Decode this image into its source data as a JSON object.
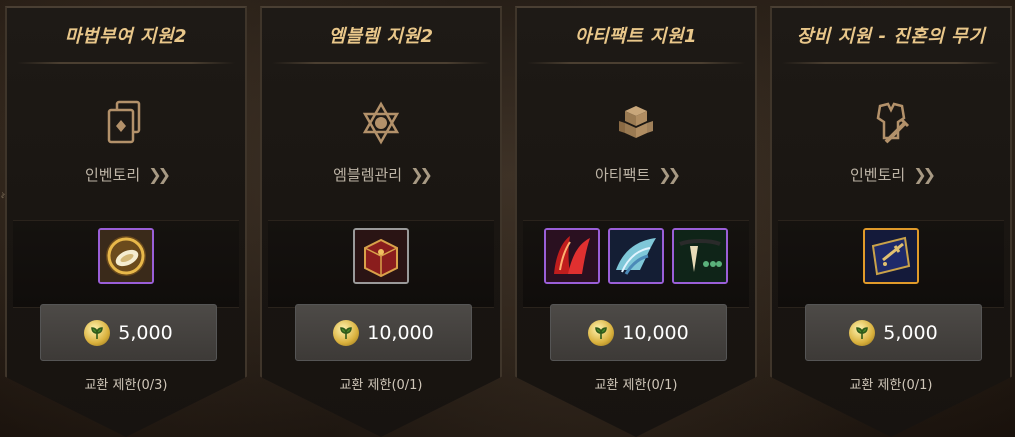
{
  "cards": [
    {
      "title": "마법부여 지원2",
      "nav_label": "인벤토리",
      "big_icon": "cards-icon",
      "items": [
        {
          "name": "enchant-scroll-item",
          "rarity": "purple"
        }
      ],
      "price": "5,000",
      "limit": "교환 제한(0/3)"
    },
    {
      "title": "엠블렘 지원2",
      "nav_label": "엠블렘관리",
      "big_icon": "hexagram-icon",
      "items": [
        {
          "name": "emblem-chest-item",
          "rarity": "gray"
        }
      ],
      "price": "10,000",
      "limit": "교환 제한(0/1)"
    },
    {
      "title": "아티팩트 지원1",
      "nav_label": "아티팩트",
      "big_icon": "cubes-icon",
      "items": [
        {
          "name": "red-wings-item",
          "rarity": "purple"
        },
        {
          "name": "blue-wings-item",
          "rarity": "purple"
        },
        {
          "name": "fang-necklace-item",
          "rarity": "purple"
        }
      ],
      "price": "10,000",
      "limit": "교환 제한(0/1)"
    },
    {
      "title": "장비 지원 - 진혼의 무기",
      "nav_label": "인벤토리",
      "big_icon": "armor-sword-icon",
      "items": [
        {
          "name": "weapon-book-item",
          "rarity": "orange"
        }
      ],
      "price": "5,000",
      "limit": "교환 제한(0/1)"
    }
  ],
  "colors": {
    "title_gold": "#e9c78a",
    "rarity_purple": "#9a5fd8",
    "rarity_gray": "#9a9a9a",
    "rarity_orange": "#e09a2a",
    "coin_gold": "#d9b13d"
  }
}
